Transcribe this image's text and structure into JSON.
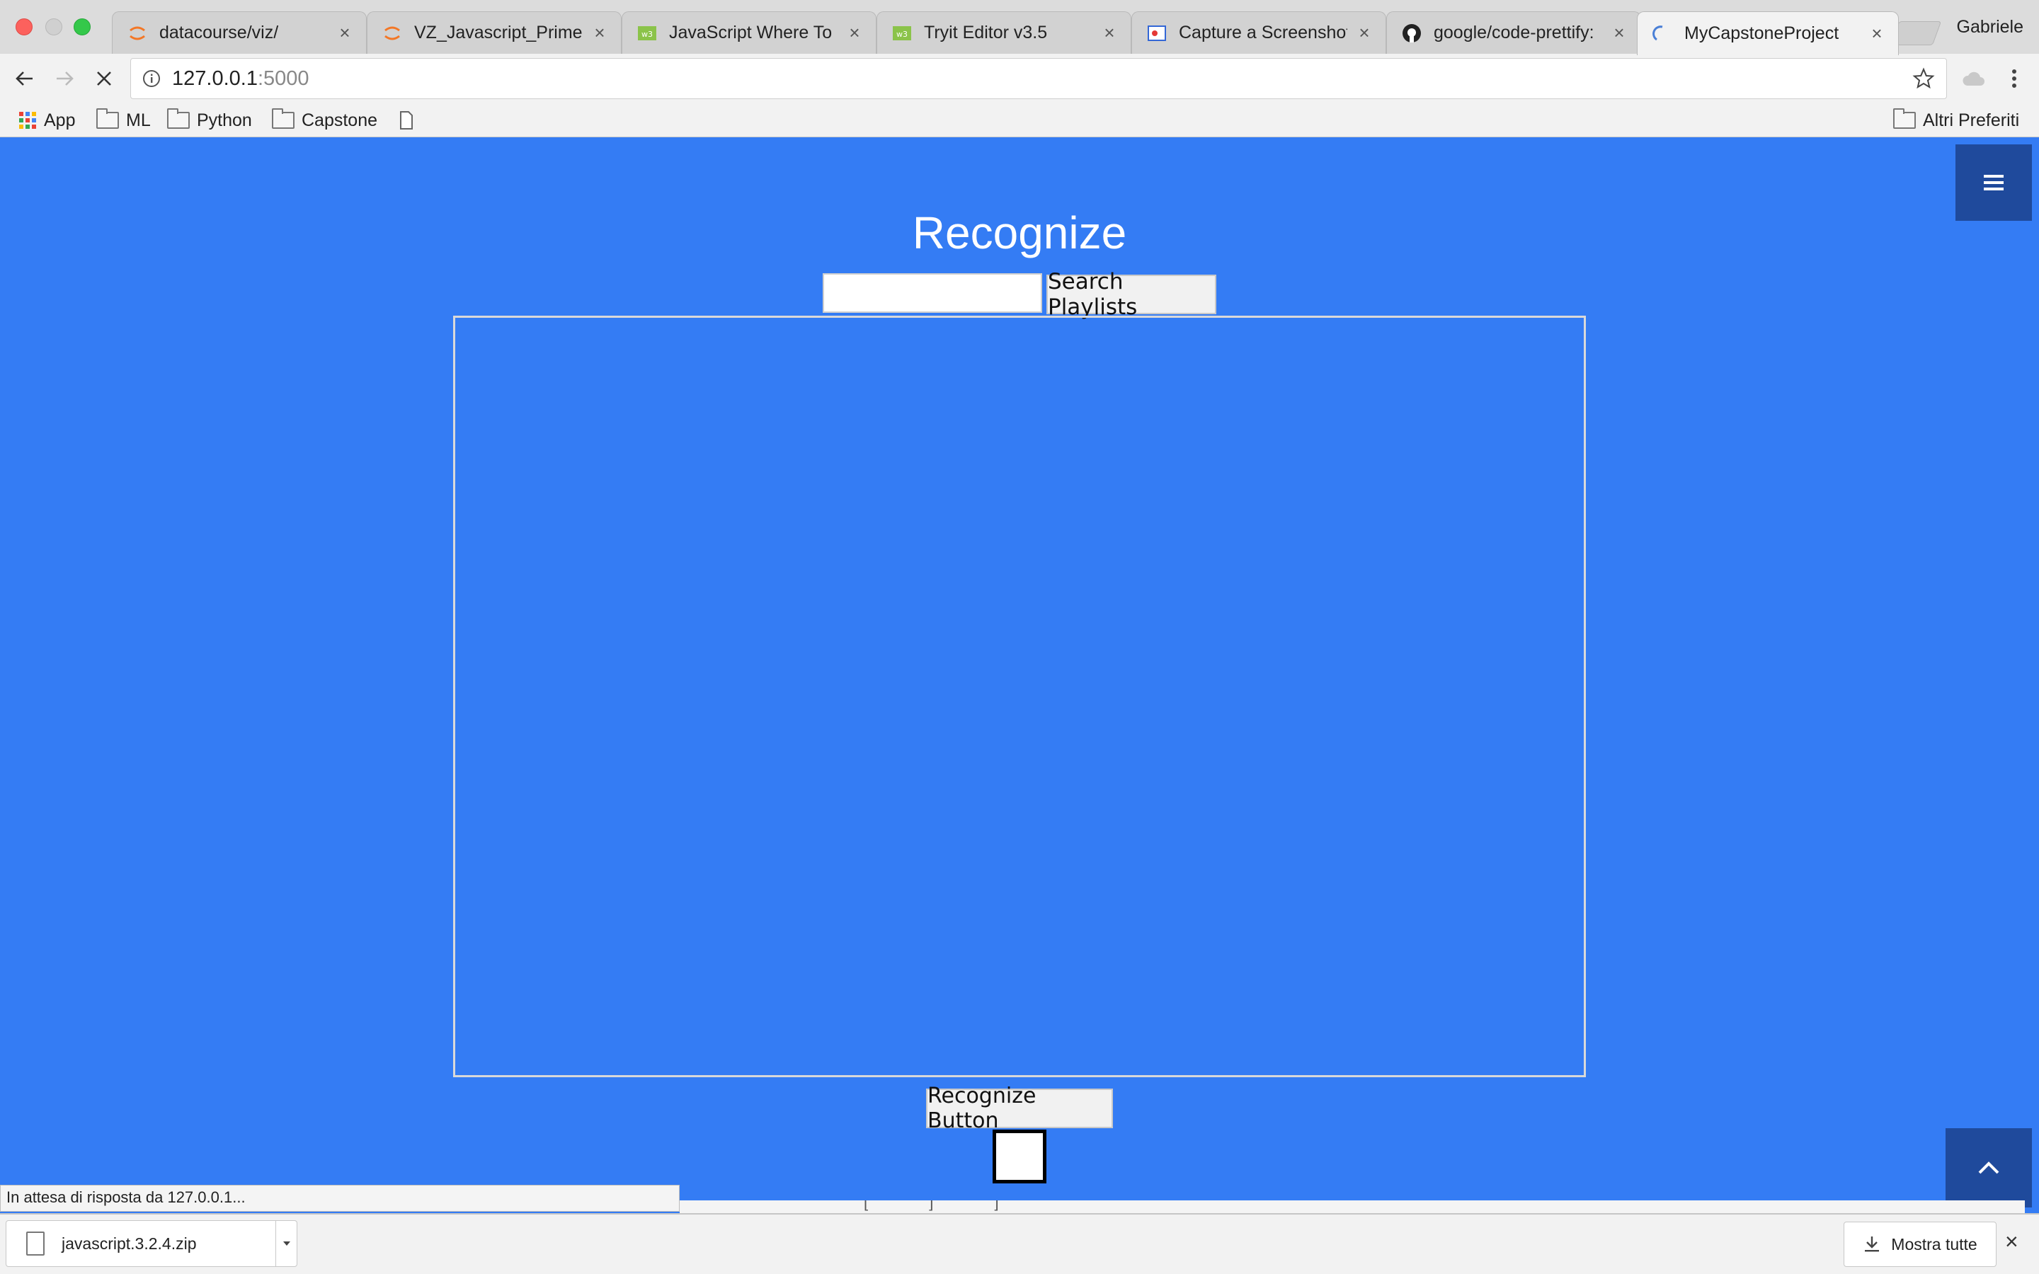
{
  "browser": {
    "tabs": [
      {
        "title": "datacourse/viz/",
        "icon": "jupyter-icon",
        "active": false
      },
      {
        "title": "VZ_Javascript_Primer",
        "icon": "jupyter-icon",
        "active": false
      },
      {
        "title": "JavaScript Where To",
        "icon": "w3schools-icon",
        "active": false
      },
      {
        "title": "Tryit Editor v3.5",
        "icon": "w3schools-icon",
        "active": false
      },
      {
        "title": "Capture a Screenshot",
        "icon": "screenshot-icon",
        "active": false
      },
      {
        "title": "google/code-prettify:",
        "icon": "github-icon",
        "active": false
      },
      {
        "title": "MyCapstoneProject",
        "icon": "loading-spinner-icon",
        "active": true
      }
    ],
    "profile_name": "Gabriele",
    "url_host": "127.0.0.1",
    "url_port": ":5000",
    "bookmarks": [
      "App",
      "ML",
      "Python",
      "Capstone"
    ],
    "other_bookmarks": "Altri Preferiti"
  },
  "page": {
    "title": "Recognize",
    "search_value": "",
    "search_button": "Search Playlists",
    "recognize_button": "Recognize Button",
    "background_color": "#347cf4",
    "accent_color": "#1f4a9c"
  },
  "status_text": "In attesa di risposta da 127.0.0.1...",
  "downloads": {
    "file_name": "javascript.3.2.4.zip",
    "show_all": "Mostra tutte"
  }
}
